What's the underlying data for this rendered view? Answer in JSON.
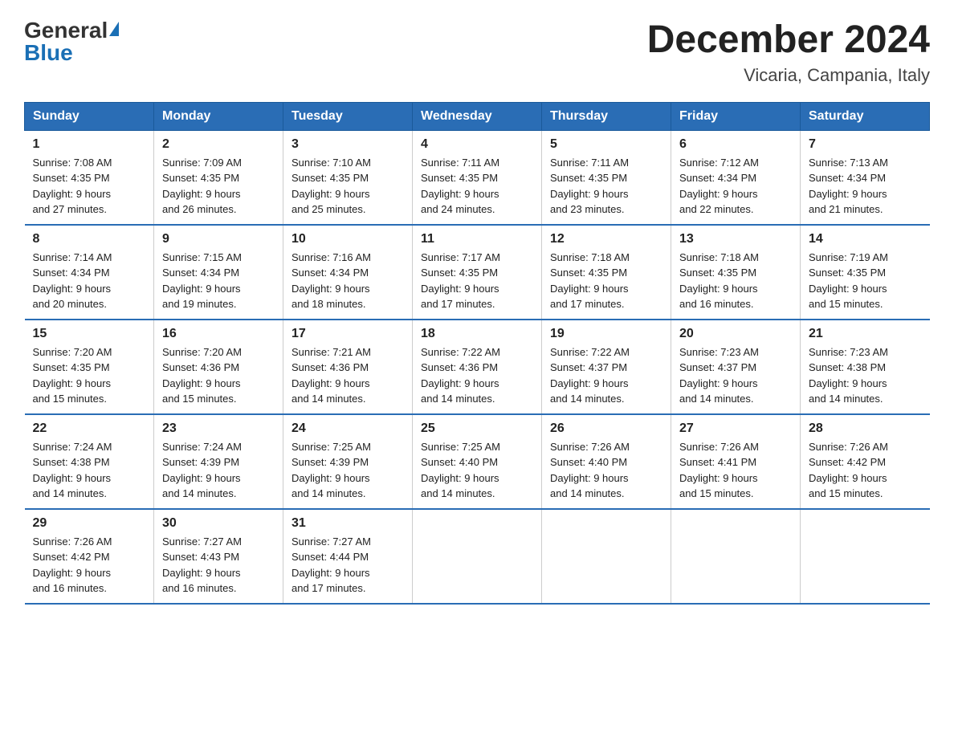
{
  "logo": {
    "general": "General",
    "blue": "Blue"
  },
  "header": {
    "month_year": "December 2024",
    "location": "Vicaria, Campania, Italy"
  },
  "days_of_week": [
    "Sunday",
    "Monday",
    "Tuesday",
    "Wednesday",
    "Thursday",
    "Friday",
    "Saturday"
  ],
  "weeks": [
    [
      {
        "day": "1",
        "sunrise": "7:08 AM",
        "sunset": "4:35 PM",
        "daylight": "9 hours and 27 minutes."
      },
      {
        "day": "2",
        "sunrise": "7:09 AM",
        "sunset": "4:35 PM",
        "daylight": "9 hours and 26 minutes."
      },
      {
        "day": "3",
        "sunrise": "7:10 AM",
        "sunset": "4:35 PM",
        "daylight": "9 hours and 25 minutes."
      },
      {
        "day": "4",
        "sunrise": "7:11 AM",
        "sunset": "4:35 PM",
        "daylight": "9 hours and 24 minutes."
      },
      {
        "day": "5",
        "sunrise": "7:11 AM",
        "sunset": "4:35 PM",
        "daylight": "9 hours and 23 minutes."
      },
      {
        "day": "6",
        "sunrise": "7:12 AM",
        "sunset": "4:34 PM",
        "daylight": "9 hours and 22 minutes."
      },
      {
        "day": "7",
        "sunrise": "7:13 AM",
        "sunset": "4:34 PM",
        "daylight": "9 hours and 21 minutes."
      }
    ],
    [
      {
        "day": "8",
        "sunrise": "7:14 AM",
        "sunset": "4:34 PM",
        "daylight": "9 hours and 20 minutes."
      },
      {
        "day": "9",
        "sunrise": "7:15 AM",
        "sunset": "4:34 PM",
        "daylight": "9 hours and 19 minutes."
      },
      {
        "day": "10",
        "sunrise": "7:16 AM",
        "sunset": "4:34 PM",
        "daylight": "9 hours and 18 minutes."
      },
      {
        "day": "11",
        "sunrise": "7:17 AM",
        "sunset": "4:35 PM",
        "daylight": "9 hours and 17 minutes."
      },
      {
        "day": "12",
        "sunrise": "7:18 AM",
        "sunset": "4:35 PM",
        "daylight": "9 hours and 17 minutes."
      },
      {
        "day": "13",
        "sunrise": "7:18 AM",
        "sunset": "4:35 PM",
        "daylight": "9 hours and 16 minutes."
      },
      {
        "day": "14",
        "sunrise": "7:19 AM",
        "sunset": "4:35 PM",
        "daylight": "9 hours and 15 minutes."
      }
    ],
    [
      {
        "day": "15",
        "sunrise": "7:20 AM",
        "sunset": "4:35 PM",
        "daylight": "9 hours and 15 minutes."
      },
      {
        "day": "16",
        "sunrise": "7:20 AM",
        "sunset": "4:36 PM",
        "daylight": "9 hours and 15 minutes."
      },
      {
        "day": "17",
        "sunrise": "7:21 AM",
        "sunset": "4:36 PM",
        "daylight": "9 hours and 14 minutes."
      },
      {
        "day": "18",
        "sunrise": "7:22 AM",
        "sunset": "4:36 PM",
        "daylight": "9 hours and 14 minutes."
      },
      {
        "day": "19",
        "sunrise": "7:22 AM",
        "sunset": "4:37 PM",
        "daylight": "9 hours and 14 minutes."
      },
      {
        "day": "20",
        "sunrise": "7:23 AM",
        "sunset": "4:37 PM",
        "daylight": "9 hours and 14 minutes."
      },
      {
        "day": "21",
        "sunrise": "7:23 AM",
        "sunset": "4:38 PM",
        "daylight": "9 hours and 14 minutes."
      }
    ],
    [
      {
        "day": "22",
        "sunrise": "7:24 AM",
        "sunset": "4:38 PM",
        "daylight": "9 hours and 14 minutes."
      },
      {
        "day": "23",
        "sunrise": "7:24 AM",
        "sunset": "4:39 PM",
        "daylight": "9 hours and 14 minutes."
      },
      {
        "day": "24",
        "sunrise": "7:25 AM",
        "sunset": "4:39 PM",
        "daylight": "9 hours and 14 minutes."
      },
      {
        "day": "25",
        "sunrise": "7:25 AM",
        "sunset": "4:40 PM",
        "daylight": "9 hours and 14 minutes."
      },
      {
        "day": "26",
        "sunrise": "7:26 AM",
        "sunset": "4:40 PM",
        "daylight": "9 hours and 14 minutes."
      },
      {
        "day": "27",
        "sunrise": "7:26 AM",
        "sunset": "4:41 PM",
        "daylight": "9 hours and 15 minutes."
      },
      {
        "day": "28",
        "sunrise": "7:26 AM",
        "sunset": "4:42 PM",
        "daylight": "9 hours and 15 minutes."
      }
    ],
    [
      {
        "day": "29",
        "sunrise": "7:26 AM",
        "sunset": "4:42 PM",
        "daylight": "9 hours and 16 minutes."
      },
      {
        "day": "30",
        "sunrise": "7:27 AM",
        "sunset": "4:43 PM",
        "daylight": "9 hours and 16 minutes."
      },
      {
        "day": "31",
        "sunrise": "7:27 AM",
        "sunset": "4:44 PM",
        "daylight": "9 hours and 17 minutes."
      },
      null,
      null,
      null,
      null
    ]
  ],
  "labels": {
    "sunrise": "Sunrise:",
    "sunset": "Sunset:",
    "daylight": "Daylight:"
  }
}
